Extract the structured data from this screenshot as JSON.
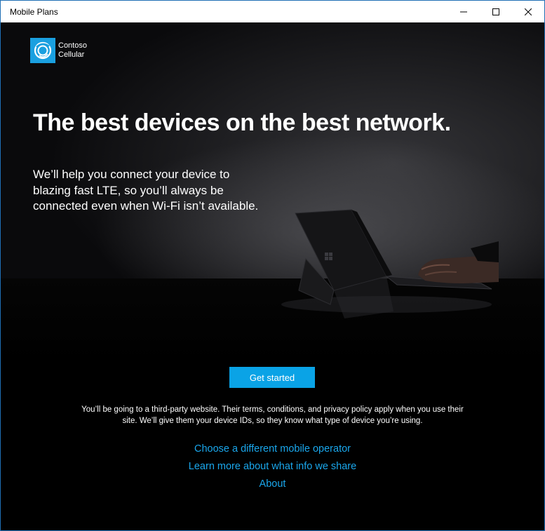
{
  "window": {
    "title": "Mobile Plans",
    "controls": [
      "minimize",
      "maximize",
      "close"
    ]
  },
  "brand": {
    "line1": "Contoso",
    "line2": "Cellular",
    "accent_color": "#1aa0e0"
  },
  "hero": {
    "headline": "The best devices on the best network.",
    "subtext": "We’ll help you connect your device to blazing fast LTE, so you’ll always be connected even when Wi‑Fi isn’t available."
  },
  "cta": {
    "label": "Get started",
    "color": "#0aa3e6"
  },
  "disclaimer": "You’ll be going to a third-party website. Their terms, conditions, and privacy policy apply when you use their site. We’ll give them your device IDs, so they know what type of device you’re using.",
  "links": {
    "choose_operator": "Choose a different mobile operator",
    "learn_more": "Learn more about what info we share",
    "about": "About",
    "color": "#1aa7ec"
  }
}
